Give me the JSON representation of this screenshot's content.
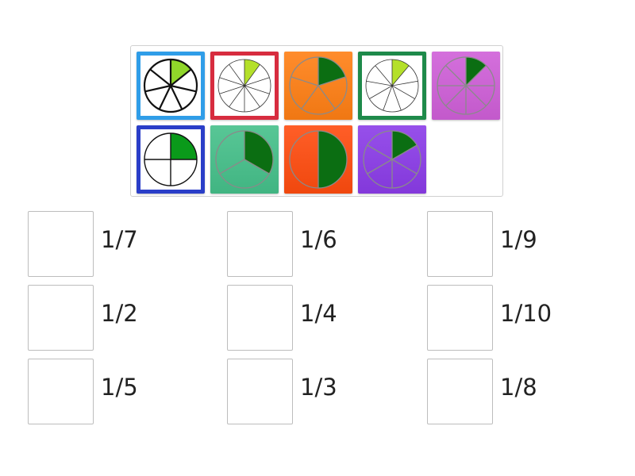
{
  "tiles": [
    {
      "id": "t1",
      "n": 7,
      "style": "framed",
      "bg": "#ffffff",
      "border": "#2f9de8",
      "fill": "#90d62a",
      "outline": "#111111",
      "stroke_w": 2.2
    },
    {
      "id": "t2",
      "n": 10,
      "style": "framed",
      "bg": "#ffffff",
      "border": "#d72c3f",
      "fill": "#b4e02a",
      "outline": "#333333",
      "stroke_w": 0.8
    },
    {
      "id": "t3",
      "n": 5,
      "style": "solid",
      "bg": "#ff7f14",
      "border": "#ff7f14",
      "fill": "#0b6e12",
      "outline": "#8a8a8a",
      "stroke_w": 1.3
    },
    {
      "id": "t4",
      "n": 9,
      "style": "framed",
      "bg": "#ffffff",
      "border": "#1e8a4a",
      "fill": "#b4e02a",
      "outline": "#333333",
      "stroke_w": 0.8
    },
    {
      "id": "t5",
      "n": 8,
      "style": "solid",
      "bg": "#cf5fd8",
      "border": "#cf5fd8",
      "fill": "#0b6e12",
      "outline": "#8a8a8a",
      "stroke_w": 1.3
    },
    {
      "id": "t6",
      "n": 4,
      "style": "framed",
      "bg": "#ffffff",
      "border": "#2a3ec8",
      "fill": "#0a9a1a",
      "outline": "#111111",
      "stroke_w": 1.4
    },
    {
      "id": "t7",
      "n": 3,
      "style": "solid",
      "bg": "#45c08a",
      "border": "#45c08a",
      "fill": "#0b6e12",
      "outline": "#8a8a8a",
      "stroke_w": 1.3
    },
    {
      "id": "t8",
      "n": 2,
      "style": "solid",
      "bg": "#ff4c0f",
      "border": "#ff4c0f",
      "fill": "#0b6e12",
      "outline": "#8a8a8a",
      "stroke_w": 1.3
    },
    {
      "id": "t9",
      "n": 6,
      "style": "solid",
      "bg": "#8b3ce8",
      "border": "#8b3ce8",
      "fill": "#0b6e12",
      "outline": "#8a8a8a",
      "stroke_w": 1.3
    }
  ],
  "targets": [
    {
      "label": "1/7"
    },
    {
      "label": "1/6"
    },
    {
      "label": "1/9"
    },
    {
      "label": "1/2"
    },
    {
      "label": "1/4"
    },
    {
      "label": "1/10"
    },
    {
      "label": "1/5"
    },
    {
      "label": "1/3"
    },
    {
      "label": "1/8"
    }
  ]
}
